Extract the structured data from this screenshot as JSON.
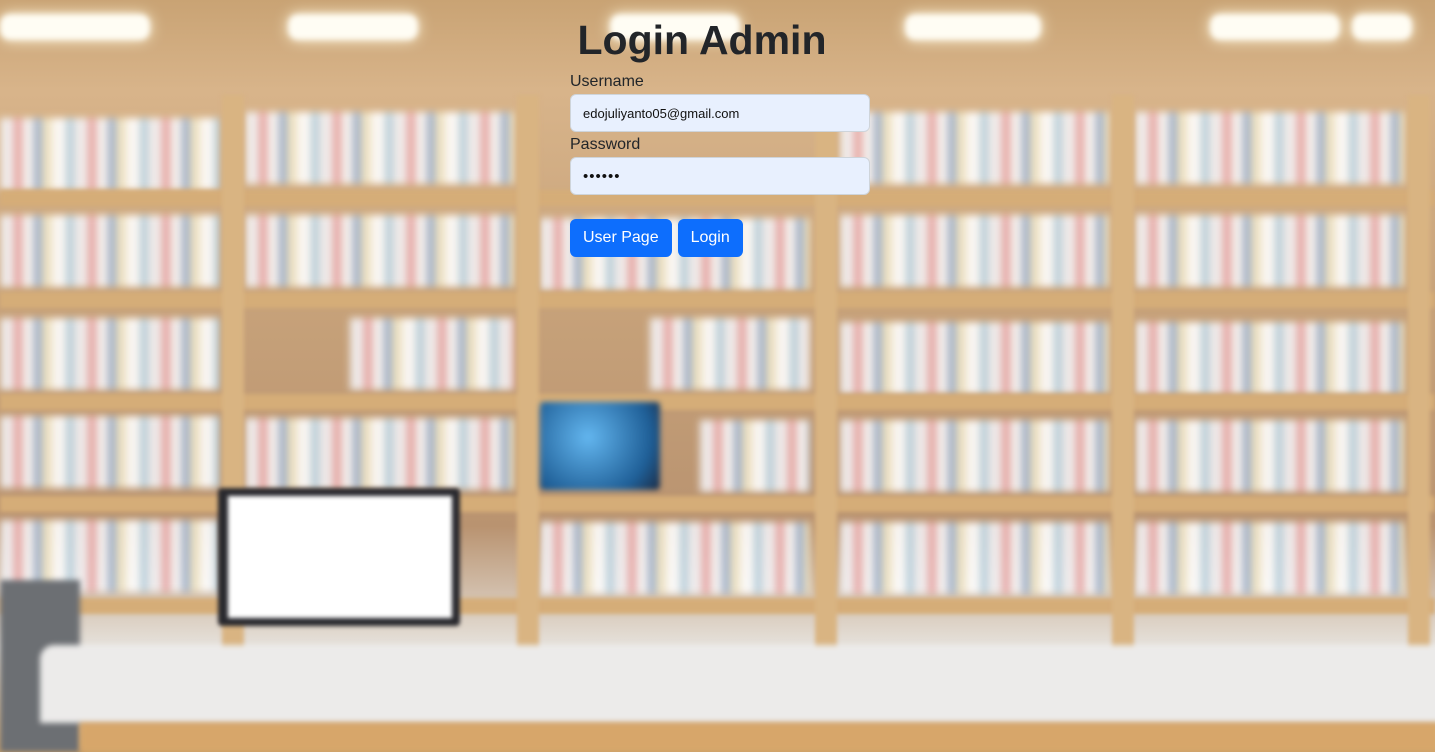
{
  "page": {
    "title": "Login Admin"
  },
  "form": {
    "username_label": "Username",
    "username_value": "edojuliyanto05@gmail.com",
    "password_label": "Password",
    "password_value": "••••••"
  },
  "buttons": {
    "user_page": "User Page",
    "login": "Login"
  },
  "colors": {
    "primary": "#0d6efd",
    "input_bg": "#e8f0fe",
    "title_text": "#222529"
  }
}
